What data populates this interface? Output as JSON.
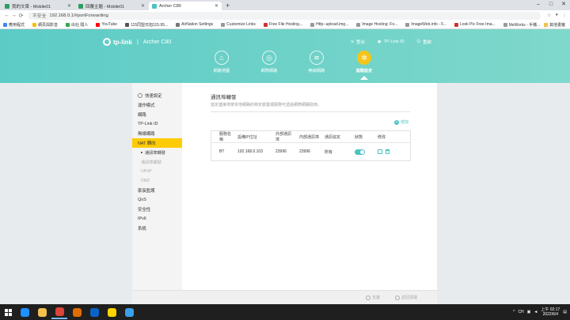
{
  "browser": {
    "tabs": [
      {
        "label": "我的文章 - Mobile01",
        "icon_color": "#2e9d63",
        "active": false
      },
      {
        "label": "回覆主題 - Mobile01",
        "icon_color": "#2e9d63",
        "active": false
      },
      {
        "label": "Archer C80",
        "icon_color": "#4bc3c2",
        "active": true
      }
    ],
    "new_tab_symbol": "+",
    "insecure_label": "不安全",
    "url": "192.168.0.1/#portForwarding",
    "bookmarks": [
      {
        "label": "應用程式",
        "color": "#4285f4"
      },
      {
        "label": "網頁與影音",
        "color": "#fbbc05"
      },
      {
        "label": "出社 隱人",
        "color": "#34a853"
      },
      {
        "label": "YouTube",
        "color": "#ff0000"
      },
      {
        "label": "115同盟日旭115.95...",
        "color": "#555"
      },
      {
        "label": "AirNation Settings",
        "color": "#777"
      },
      {
        "label": "Customize Links",
        "color": "#999"
      },
      {
        "label": "Free File Hosting...",
        "color": "#c33"
      },
      {
        "label": "Http--upload.img...",
        "color": "#999"
      },
      {
        "label": "Image Hosting: Fo...",
        "color": "#999"
      },
      {
        "label": "ImageWeb.info - F...",
        "color": "#999"
      },
      {
        "label": "Look Pic Free Ima...",
        "color": "#c33"
      },
      {
        "label": "MeWorks - 手機...",
        "color": "#999"
      }
    ],
    "other_bookmarks": "其他書籤"
  },
  "router": {
    "logo_text": "tp-link",
    "model": "Archer C80",
    "header_links": [
      "登出",
      "TP-Link ID",
      "重啟"
    ],
    "nav": [
      {
        "label": "網路地圖",
        "icon": "network-map-icon",
        "glyph": "⌂",
        "active": false
      },
      {
        "label": "網際網路",
        "icon": "globe-icon",
        "glyph": "◎",
        "active": false
      },
      {
        "label": "無線網路",
        "icon": "wifi-icon",
        "glyph": "≋",
        "active": false
      },
      {
        "label": "進階設定",
        "icon": "gear-icon",
        "glyph": "✲",
        "active": true
      }
    ],
    "sidebar": [
      {
        "label": "快速設定",
        "type": "item",
        "state": "first"
      },
      {
        "label": "運作模式",
        "type": "item",
        "state": ""
      },
      {
        "label": "網路",
        "type": "item",
        "state": ""
      },
      {
        "label": "TP-Link ID",
        "type": "item",
        "state": ""
      },
      {
        "label": "無線網路",
        "type": "item",
        "state": ""
      },
      {
        "label": "NAT 轉向",
        "type": "item",
        "state": "active"
      },
      {
        "label": "通訊埠轉發",
        "type": "sub",
        "state": "active"
      },
      {
        "label": "通訊埠觸發",
        "type": "sub",
        "state": ""
      },
      {
        "label": "UPnP",
        "type": "sub",
        "state": ""
      },
      {
        "label": "DMZ",
        "type": "sub",
        "state": ""
      },
      {
        "label": "家長監護",
        "type": "item",
        "state": ""
      },
      {
        "label": "QoS",
        "type": "item",
        "state": ""
      },
      {
        "label": "安全性",
        "type": "item",
        "state": ""
      },
      {
        "label": "IPv6",
        "type": "item",
        "state": ""
      },
      {
        "label": "系統",
        "type": "item",
        "state": ""
      }
    ],
    "page_title": "通訊埠轉發",
    "page_desc": "指定連接埠使本地網路的特定裝置或服務可透過網際網路取用。",
    "add_label": "增加",
    "table": {
      "headers": [
        "服務名稱",
        "設備IP位址",
        "外部通訊埠",
        "內部通訊埠",
        "通訊協定",
        "狀態",
        "修改"
      ],
      "rows": [
        {
          "name": "BT",
          "ip": "192.168.0.103",
          "ext_port": "23996",
          "int_port": "23996",
          "protocol": "所有",
          "status_on": true
        }
      ]
    },
    "footer": {
      "support": "支援",
      "back_to_top": "返回頂端"
    }
  },
  "taskbar": {
    "apps": [
      {
        "icon": "ie-icon",
        "color": "#1e90ff",
        "running": false
      },
      {
        "icon": "folder-icon",
        "color": "#f2c14e",
        "running": false
      },
      {
        "icon": "chrome-icon",
        "color": "#db4437",
        "running": true
      },
      {
        "icon": "media-icon",
        "color": "#e06c00",
        "running": false
      },
      {
        "icon": "outlook-icon",
        "color": "#0a64c8",
        "running": false
      },
      {
        "icon": "sticky-icon",
        "color": "#ffd400",
        "running": false
      },
      {
        "icon": "paint-icon",
        "color": "#3aa0e8",
        "running": false
      }
    ],
    "lang": "CH",
    "time": "上午 02:17",
    "date": "2022/6/4"
  }
}
